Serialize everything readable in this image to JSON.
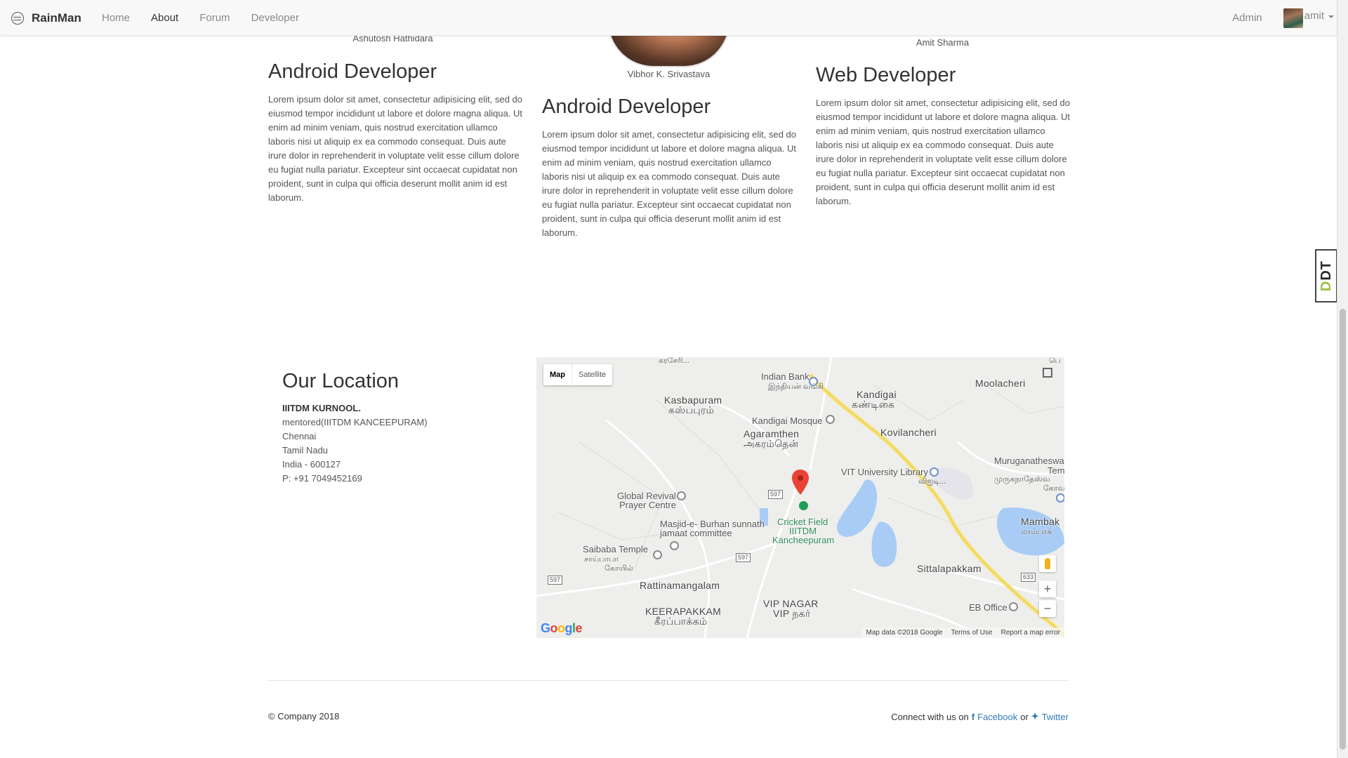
{
  "navbar": {
    "brand": "RainMan",
    "links": [
      "Home",
      "About",
      "Forum",
      "Developer"
    ],
    "active": "About",
    "admin": "Admin",
    "user": "amit"
  },
  "team": [
    {
      "name": "Ashutosh Hathidara",
      "role": "Android Developer",
      "bio": "Lorem ipsum dolor sit amet, consectetur adipisicing elit, sed do eiusmod tempor incididunt ut labore et dolore magna aliqua. Ut enim ad minim veniam, quis nostrud exercitation ullamco laboris nisi ut aliquip ex ea commodo consequat. Duis aute irure dolor in reprehenderit in voluptate velit esse cillum dolore eu fugiat nulla pariatur. Excepteur sint occaecat cupidatat non proident, sunt in culpa qui officia deserunt mollit anim id est laborum."
    },
    {
      "name": "Vibhor K. Srivastava",
      "role": "Android Developer",
      "bio": "Lorem ipsum dolor sit amet, consectetur adipisicing elit, sed do eiusmod tempor incididunt ut labore et dolore magna aliqua. Ut enim ad minim veniam, quis nostrud exercitation ullamco laboris nisi ut aliquip ex ea commodo consequat. Duis aute irure dolor in reprehenderit in voluptate velit esse cillum dolore eu fugiat nulla pariatur. Excepteur sint occaecat cupidatat non proident, sunt in culpa qui officia deserunt mollit anim id est laborum."
    },
    {
      "name": "Amit Sharma",
      "role": "Web Developer",
      "bio": "Lorem ipsum dolor sit amet, consectetur adipisicing elit, sed do eiusmod tempor incididunt ut labore et dolore magna aliqua. Ut enim ad minim veniam, quis nostrud exercitation ullamco laboris nisi ut aliquip ex ea commodo consequat. Duis aute irure dolor in reprehenderit in voluptate velit esse cillum dolore eu fugiat nulla pariatur. Excepteur sint occaecat cupidatat non proident, sunt in culpa qui officia deserunt mollit anim id est laborum."
    }
  ],
  "ddt_tab": {
    "prefix": "D",
    "suffix": "DT"
  },
  "location": {
    "title": "Our Location",
    "org": "IIITDM KURNOOL.",
    "lines": [
      "mentored(IIITDM KANCEEPURAM)",
      "Chennai",
      "Tamil Nadu",
      "India - 600127",
      "P: +91 7049452169"
    ]
  },
  "map": {
    "type_buttons": [
      "Map",
      "Satellite"
    ],
    "selected_type": "Map",
    "labels": {
      "indian_bank": "Indian Bank",
      "indian_bank_ta": "இந்தியன் வங்கி",
      "moolacheri": "Moolacheri",
      "kasbapuram": "Kasbapuram",
      "kasbapuram_ta": "கஸ்பபுரம்",
      "kandigai": "Kandigai",
      "kandigai_ta": "கண்டிகை",
      "kandigai_mosque": "Kandigai Mosque",
      "agaramthen": "Agaramthen",
      "agaramthen_ta": "அகரம்தென்",
      "kovilancheri": "Kovilancheri",
      "vit_library": "VIT University Library",
      "vit_library_ta": "விஐடி...",
      "muruganatheswa": "Muruganatheswa",
      "muruganatheswa_2": "Tem",
      "muruganatheswa_ta": "முருகநாதேஸ்வ",
      "muruganatheswa_ta2": "கோவ",
      "global_revival": "Global Revival",
      "global_revival_2": "Prayer Centre",
      "masjid": "Masjid-e- Burhan sunnath",
      "masjid_2": "jamaat committee",
      "cricket_field": "Cricket Field",
      "cricket_field_2": "IIITDM",
      "cricket_field_3": "Kancheepuram",
      "mambak": "Mambak",
      "mambak_ta": "மாம்பாக்",
      "saibaba": "Saibaba Temple",
      "saibaba_ta": "சாய்பாபா",
      "saibaba_ta2": "கோயில்",
      "rattinamangalam": "Rattinamangalam",
      "sittalapakkam": "Sittalapakkam",
      "vip_nagar": "VIP NAGAR",
      "vip_nagar_ta": "VIP நகர்",
      "keerapakkam": "KEERAPAKKAM",
      "keerapakkam_ta": "கீரப்பாக்கம்",
      "eb_office": "EB Office",
      "top_partial": "கரசேரி...",
      "right_partial": "பெ"
    },
    "shields": [
      "597",
      "597",
      "597",
      "633"
    ],
    "footer": [
      "Map data ©2018 Google",
      "Terms of Use",
      "Report a map error"
    ],
    "logo": "Google"
  },
  "footer": {
    "copyright": "© Company 2018",
    "connect_prefix": "Connect with us on",
    "facebook": "Facebook",
    "or": "or",
    "twitter": "Twitter"
  }
}
